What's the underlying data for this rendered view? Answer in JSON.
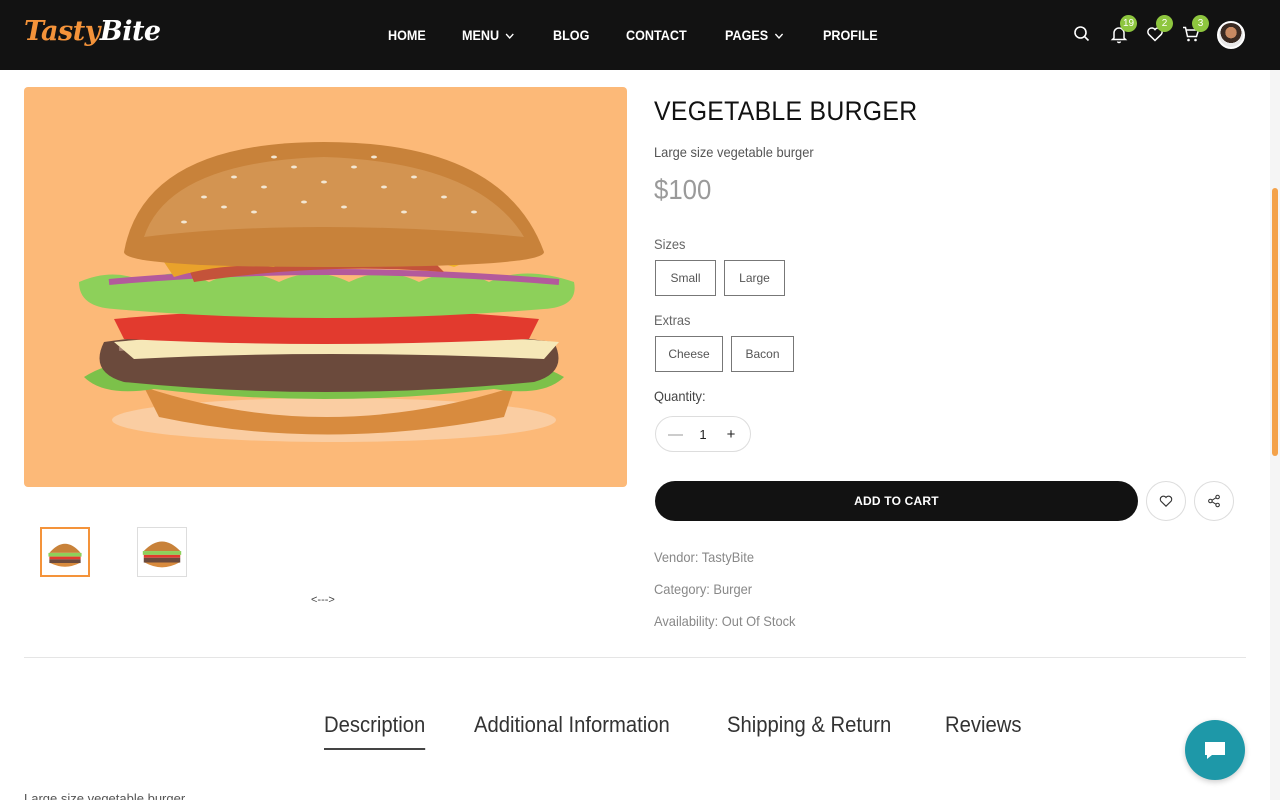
{
  "header": {
    "logo_part1": "Tasty",
    "logo_part2": "Bite",
    "nav": [
      {
        "label": "HOME"
      },
      {
        "label": "MENU"
      },
      {
        "label": "BLOG"
      },
      {
        "label": "CONTACT"
      },
      {
        "label": "PAGES"
      },
      {
        "label": "PROFILE"
      }
    ],
    "badges": {
      "notifications": "19",
      "wishlist": "2",
      "cart": "3"
    }
  },
  "product": {
    "title": "VEGETABLE BURGER",
    "subtitle": "Large size vegetable burger",
    "price": "$100",
    "sizes_label": "Sizes",
    "sizes": [
      "Small",
      "Large"
    ],
    "extras_label": "Extras",
    "extras": [
      "Cheese",
      "Bacon"
    ],
    "quantity_label": "Quantity:",
    "quantity": "1",
    "quantity_minus": "—",
    "quantity_plus": "+",
    "add_to_cart": "ADD TO CART",
    "vendor": "Vendor: TastyBite",
    "category": "Category: Burger",
    "availability": "Availability: Out Of Stock",
    "gallery_arrows": "<--->"
  },
  "tabs": [
    {
      "label": "Description",
      "active": true
    },
    {
      "label": "Additional Information"
    },
    {
      "label": "Shipping & Return"
    },
    {
      "label": "Reviews"
    }
  ],
  "description_peek": "Large size vegetable burger",
  "colors": {
    "accent": "#f4933a",
    "badge": "#8ec63f",
    "header_bg": "#121212",
    "image_bg": "#fcb978",
    "chat": "#1e98a8"
  },
  "icons": [
    "search-icon",
    "bell-icon",
    "heart-icon",
    "cart-icon",
    "share-icon",
    "chat-icon",
    "chevron-down-icon"
  ]
}
